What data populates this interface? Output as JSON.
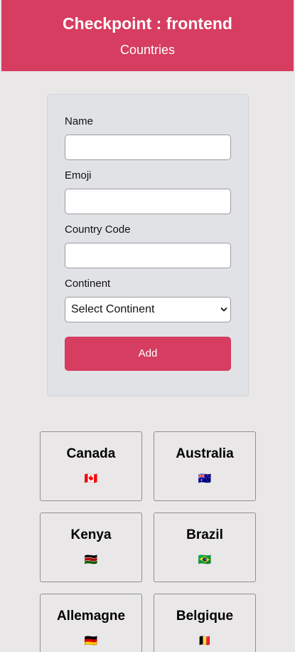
{
  "colors": {
    "brand": "#d63d61",
    "page_background": "#e9e7e8",
    "form_background": "#e1e2e6"
  },
  "header": {
    "title": "Checkpoint : frontend",
    "subtitle": "Countries"
  },
  "form": {
    "name_label": "Name",
    "name_value": "",
    "emoji_label": "Emoji",
    "emoji_value": "",
    "code_label": "Country Code",
    "code_value": "",
    "continent_label": "Continent",
    "continent_selected": "Select Continent",
    "add_label": "Add"
  },
  "countries": [
    {
      "name": "Canada",
      "emoji": "🇨🇦"
    },
    {
      "name": "Australia",
      "emoji": "🇦🇺"
    },
    {
      "name": "Kenya",
      "emoji": "🇰🇪"
    },
    {
      "name": "Brazil",
      "emoji": "🇧🇷"
    },
    {
      "name": "Allemagne",
      "emoji": "🇩🇪"
    },
    {
      "name": "Belgique",
      "emoji": "🇧🇪"
    }
  ]
}
